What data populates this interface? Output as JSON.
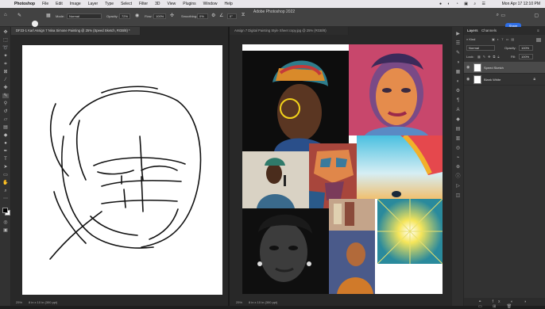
{
  "menubar": {
    "app_name": "Photoshop",
    "items": [
      "File",
      "Edit",
      "Image",
      "Layer",
      "Type",
      "Select",
      "Filter",
      "3D",
      "View",
      "Plugins",
      "Window",
      "Help"
    ],
    "clock": "Mon Apr 17  12:10 PM"
  },
  "window": {
    "title": "Adobe Photoshop 2022"
  },
  "options": {
    "mode_label": "Mode:",
    "mode_value": "Normal",
    "opacity_label": "Opacity:",
    "opacity_value": "72%",
    "flow_label": "Flow:",
    "flow_value": "100%",
    "smoothing_label": "Smoothing:",
    "smoothing_value": "0%",
    "angle_value": "0°",
    "share_label": "Share"
  },
  "documents": {
    "left_tab": "DF23-1 Karl Assign 7 Nina Simone Painting @ 25% (Speed Sketch, RGB/8) *",
    "right_tab": "Assign 7 Digital Painting Style Sheet copy.jpg @ 25% (RGB/8)",
    "left_zoom": "25%",
    "left_size": "8 in x 10 in (300 ppi)",
    "right_zoom": "25%",
    "right_size": "8 in x 10 in (300 ppi)"
  },
  "panel": {
    "tabs": [
      "Layers",
      "Channels"
    ],
    "kind_label": "Kind",
    "blend_mode": "Normal",
    "opacity_label": "Opacity:",
    "opacity_value": "100%",
    "lock_label": "Lock:",
    "fill_label": "Fill:",
    "fill_value": "100%",
    "layers": [
      {
        "name": "Speed Sketch",
        "selected": true
      },
      {
        "name": "Blank White",
        "selected": false
      }
    ]
  },
  "colors": {
    "app_bg": "#1e1e1e",
    "panel_bg": "#323232",
    "accent_blue": "#2f6fe6",
    "yellow_circle": "#f2d21b"
  }
}
